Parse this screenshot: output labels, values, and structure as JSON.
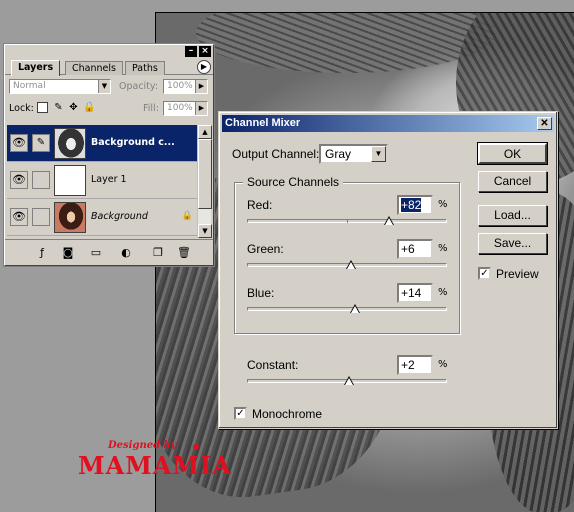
{
  "layers_panel": {
    "tabs": [
      "Layers",
      "Channels",
      "Paths"
    ],
    "blend_mode": "Normal",
    "opacity_label": "Opacity:",
    "opacity_value": "100%",
    "lock_label": "Lock:",
    "fill_label": "Fill:",
    "fill_value": "100%",
    "layers": [
      {
        "name": "Background c...",
        "selected": true
      },
      {
        "name": "Layer 1",
        "selected": false
      },
      {
        "name": "Background",
        "selected": false,
        "italic": true,
        "locked": true
      }
    ],
    "icons": [
      "eye-icon",
      "brush-icon",
      "lock-icon",
      "new-layer-icon",
      "trash-icon"
    ]
  },
  "channel_mixer": {
    "title": "Channel Mixer",
    "output_channel_label": "Output Channel:",
    "output_channel_value": "Gray",
    "source_channels_label": "Source Channels",
    "red_label": "Red:",
    "red_value": "+82",
    "green_label": "Green:",
    "green_value": "+6",
    "blue_label": "Blue:",
    "blue_value": "+14",
    "constant_label": "Constant:",
    "constant_value": "+2",
    "percent": "%",
    "monochrome_label": "Monochrome",
    "monochrome_checked": true,
    "preview_label": "Preview",
    "preview_checked": true,
    "buttons": {
      "ok": "OK",
      "cancel": "Cancel",
      "load": "Load...",
      "save": "Save..."
    },
    "slider_levels": {
      "red": 0.705,
      "green": 0.515,
      "blue": 0.535,
      "constant": 0.505
    }
  },
  "logo": {
    "line1": "Designed by",
    "line2": "MAMAMIA",
    "color": "#e01020"
  }
}
